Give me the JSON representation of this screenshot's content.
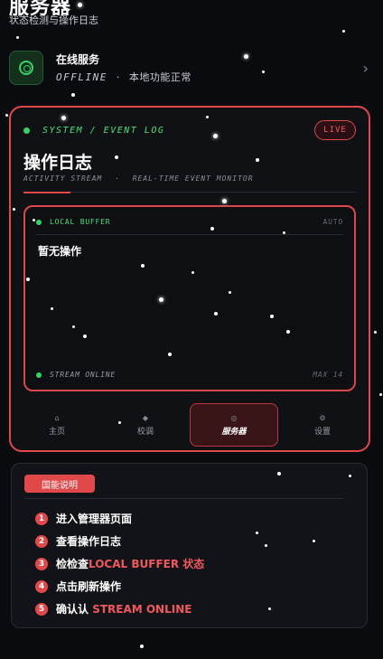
{
  "header": {
    "title": "服务器",
    "subtitle": "状态检测与操作日志"
  },
  "server": {
    "name": "在线服务",
    "status": "OFFLINE",
    "separator": "·",
    "note": "本地功能正常",
    "icon": "server-ring-icon",
    "chevron": "chevron-right-icon"
  },
  "log_panel": {
    "section_label": "SYSTEM / EVENT LOG",
    "live_badge": "LIVE",
    "title": "操作日志",
    "subtitle_left": "ACTIVITY STREAM",
    "subtitle_sep": "·",
    "subtitle_right": "REAL-TIME EVENT MONITOR",
    "buffer": {
      "label": "LOCAL BUFFER",
      "mode": "AUTO",
      "empty_text": "暂无操作",
      "footer_status": "STREAM ONLINE",
      "footer_max": "MAX 14"
    }
  },
  "nav": {
    "items": [
      {
        "label": "主页",
        "icon": "home-icon",
        "glyph": "⌂",
        "active": false
      },
      {
        "label": "校调",
        "icon": "diamond-icon",
        "glyph": "◆",
        "active": false
      },
      {
        "label": "服务器",
        "icon": "server-icon",
        "glyph": "◎",
        "active": true
      },
      {
        "label": "设置",
        "icon": "gear-icon",
        "glyph": "⚙",
        "active": false
      }
    ]
  },
  "features": {
    "badge": "国能说明",
    "items": [
      {
        "num": "1",
        "text": "进入管理器页面",
        "highlight": ""
      },
      {
        "num": "2",
        "text": "查看操作日志",
        "highlight": ""
      },
      {
        "num": "3",
        "text": "检检查",
        "highlight": "LOCAL BUFFER 状态"
      },
      {
        "num": "4",
        "text": "点击刷新操作",
        "highlight": ""
      },
      {
        "num": "5",
        "text": "确认认 ",
        "highlight": "STREAM ONLINE"
      }
    ]
  },
  "colors": {
    "accent_red": "#e0484a",
    "online_green": "#35d46a",
    "background": "#0a0b0f"
  }
}
